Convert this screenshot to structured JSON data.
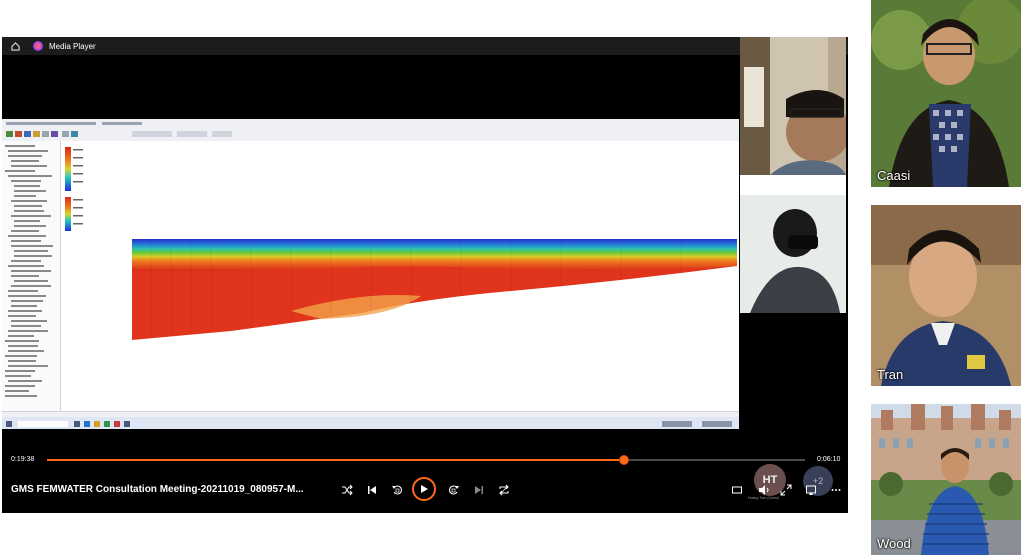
{
  "player": {
    "app_title": "Media Player",
    "media_title": "GMS FEMWATER Consultation Meeting-20211019_080957-M...",
    "elapsed": "0:19:38",
    "remaining": "0:06:10",
    "progress": 0.76,
    "controls": [
      "shuffle-icon",
      "previous-icon",
      "rewind-10-icon",
      "play-icon",
      "forward-30-icon",
      "next-icon",
      "repeat-icon"
    ],
    "right_controls": [
      "miniplayer-icon",
      "volume-icon",
      "fullscreen-icon",
      "cast-icon",
      "more-icon"
    ]
  },
  "call": {
    "avatar_initials": "HT",
    "avatar_label": "Huang Tran (Guest)",
    "more_count": "+2"
  },
  "participants": [
    {
      "name": "Caasi"
    },
    {
      "name": "Tran"
    },
    {
      "name": "Wood"
    }
  ],
  "colors": {
    "accent": "#ff6a18",
    "player_bg": "#000000",
    "titlebar_bg": "#1c1c1c"
  }
}
